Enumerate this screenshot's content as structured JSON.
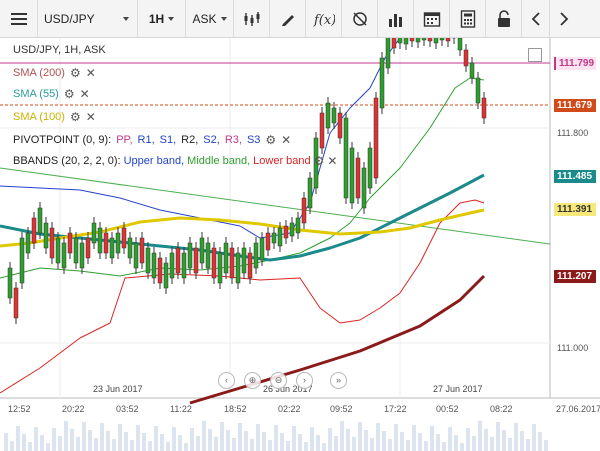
{
  "toolbar": {
    "symbol": "USD/JPY",
    "timeframe": "1H",
    "price_side": "ASK"
  },
  "chart_title": "USD/JPY, 1H, ASK",
  "indicators": {
    "sma200": {
      "label": "SMA (200)",
      "color": "#b05050"
    },
    "sma55": {
      "label": "SMA (55)",
      "color": "#2a9d9d"
    },
    "sma100": {
      "label": "SMA (100)",
      "color": "#c9b400"
    },
    "pivot": {
      "prefix": "PIVOTPOINT (0, 9):",
      "pp": "PP,",
      "r1": "R1,",
      "s1": "S1,",
      "r2": "R2,",
      "s2": "S2,",
      "r3": "R3,",
      "s3": "S3"
    },
    "bbands": {
      "prefix": "BBANDS (20, 2, 2, 0):",
      "upper": "Upper band,",
      "middle": "Middle band,",
      "lower": "Lower band"
    }
  },
  "price_axis": {
    "labels": [
      "111.800",
      "111.000"
    ],
    "tags": [
      {
        "value": "111.799",
        "color": "#c0388c"
      },
      {
        "value": "111.679",
        "color": "#d14b1a"
      },
      {
        "value": "111.485",
        "color": "#1a8a8a"
      },
      {
        "value": "111.391",
        "color": "#c9a800"
      },
      {
        "value": "111.207",
        "color": "#8b1a1a"
      }
    ]
  },
  "time_axis": [
    "12:52",
    "20:22",
    "03:52",
    "11:22",
    "18:52",
    "02:22",
    "09:52",
    "17:22",
    "00:52",
    "08:22",
    "27.06.2017"
  ],
  "date_labels": [
    "23 Jun 2017",
    "26 Jun 2017",
    "27 Jun 2017"
  ],
  "chart_data": {
    "type": "candlestick",
    "title": "USD/JPY, 1H, ASK",
    "series": [
      {
        "name": "SMA (200)"
      },
      {
        "name": "SMA (55)"
      },
      {
        "name": "SMA (100)"
      },
      {
        "name": "BBANDS Upper band"
      },
      {
        "name": "BBANDS Middle band"
      },
      {
        "name": "BBANDS Lower band"
      }
    ]
  }
}
